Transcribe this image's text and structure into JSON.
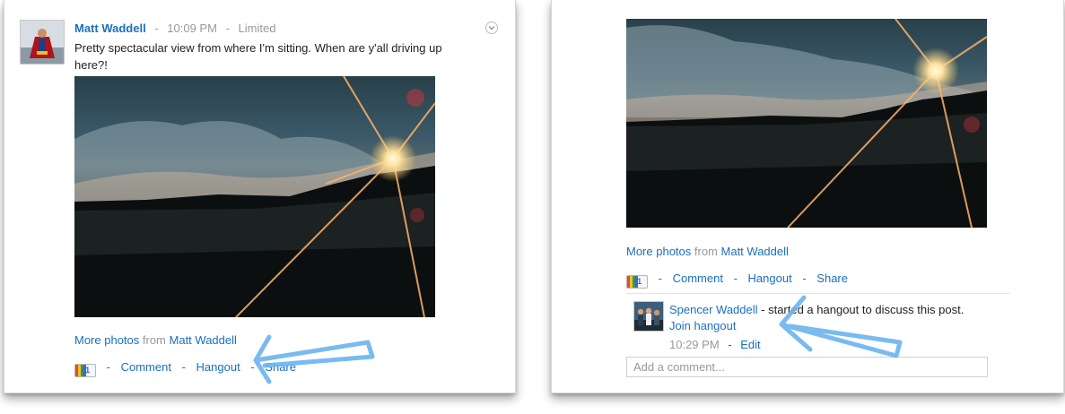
{
  "left_post": {
    "author": "Matt Waddell",
    "time": "10:09 PM",
    "visibility": "Limited",
    "text": "Pretty spectacular view from where I'm sitting. When are y'all driving up here?!",
    "more_photos": "More photos",
    "from": "from",
    "photo_author": "Matt Waddell",
    "plus_one": "+1",
    "actions": {
      "comment": "Comment",
      "hangout": "Hangout",
      "share": "Share"
    },
    "dash": "-"
  },
  "right_post": {
    "more_photos": "More photos",
    "from": "from",
    "photo_author": "Matt Waddell",
    "plus_one": "+1",
    "actions": {
      "comment": "Comment",
      "hangout": "Hangout",
      "share": "Share"
    },
    "dash": "-",
    "hangout_entry": {
      "user": "Spencer Waddell",
      "message": "- started a hangout to discuss this post.",
      "join": "Join hangout",
      "time": "10:29 PM",
      "edit": "Edit"
    },
    "comment_placeholder": "Add a comment..."
  },
  "colors": {
    "link": "#1a6fc0",
    "arrow": "#6ab4ee",
    "muted": "#999999"
  },
  "icons": {
    "menu": "chevron-down-circle-icon",
    "arrow": "hand-drawn-arrow-icon"
  }
}
